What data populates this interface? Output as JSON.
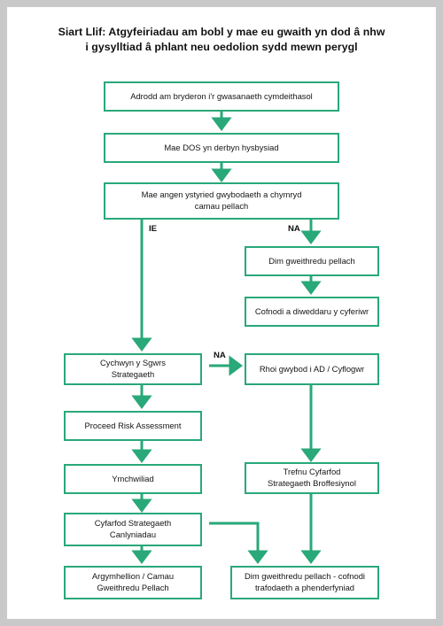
{
  "page": {
    "border_color": "#c9c9c9",
    "background_color": "#ffffff",
    "accent_color": "#29a879",
    "text_color": "#151515"
  },
  "title": {
    "line1": "Siart Llif: Atgyfeiriadau am bobl y mae eu gwaith yn dod â nhw",
    "line2": "i gysylltiad â phlant neu oedolion sydd mewn perygl"
  },
  "flowchart": {
    "type": "flowchart",
    "nodes": [
      {
        "id": "n1",
        "label": "Adrodd am bryderon i'r gwasanaeth cymdeithasol"
      },
      {
        "id": "n2",
        "label": "Mae DOS yn derbyn hysbysiad"
      },
      {
        "id": "n3",
        "label": "Mae angen ystyried gwybodaeth a chymryd\ncamau pellach"
      },
      {
        "id": "n4",
        "label": "Dim gweithredu pellach"
      },
      {
        "id": "n5",
        "label": "Cofnodi a diweddaru y cyferiwr"
      },
      {
        "id": "n6",
        "label": "Cychwyn y Sgwrs\nStrategaeth"
      },
      {
        "id": "n7",
        "label": "Rhoi gwybod i AD / Cyflogwr"
      },
      {
        "id": "n8",
        "label": "Proceed Risk Assessment"
      },
      {
        "id": "n9",
        "label": "Ymchwiliad"
      },
      {
        "id": "n10",
        "label": "Trefnu Cyfarfod\nStrategaeth Broffesiynol"
      },
      {
        "id": "n11",
        "label": "Cyfarfod Strategaeth\nCanlyniadau"
      },
      {
        "id": "n12",
        "label": "Argymhellion / Camau\nGweithredu Pellach"
      },
      {
        "id": "n13",
        "label": "Dim gweithredu pellach - cofnodi\ntrafodaeth a phenderfyniad"
      }
    ],
    "edge_labels": [
      {
        "id": "e1",
        "label": "IE"
      },
      {
        "id": "e2",
        "label": "NA"
      },
      {
        "id": "e3",
        "label": "NA"
      }
    ]
  }
}
